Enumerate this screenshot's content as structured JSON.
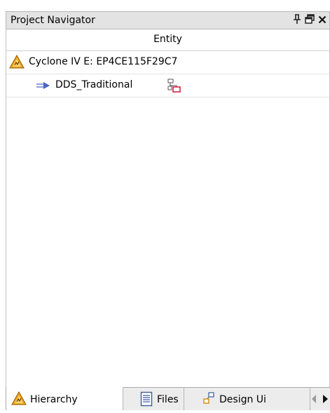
{
  "panel": {
    "title": "Project Navigator",
    "controls": {
      "pin": "pin-icon",
      "restore": "restore-window-icon",
      "close": "close-icon"
    }
  },
  "tree": {
    "column_header": "Entity",
    "rows": [
      {
        "label": "Cyclone IV E: EP4CE115F29C7",
        "icon": "device-warning-icon",
        "level": 0
      },
      {
        "label": "DDS_Traditional",
        "icon": "entity-arrow-icon",
        "trailing_icon": "hierarchy-block-icon",
        "level": 1
      }
    ]
  },
  "tabs": [
    {
      "label": "Hierarchy",
      "icon": "device-warning-icon",
      "active": true
    },
    {
      "label": "Files",
      "icon": "file-icon",
      "active": false
    },
    {
      "label": "Design Ui",
      "icon": "design-units-icon",
      "active": false
    }
  ],
  "tab_scroll": {
    "left": "scroll-left-arrow-icon",
    "right": "scroll-right-arrow-icon"
  },
  "colors": {
    "titlebar_bg": "#e3e3e3",
    "warning_orange": "#f0a020",
    "tab_bar_bg": "#ececec"
  }
}
